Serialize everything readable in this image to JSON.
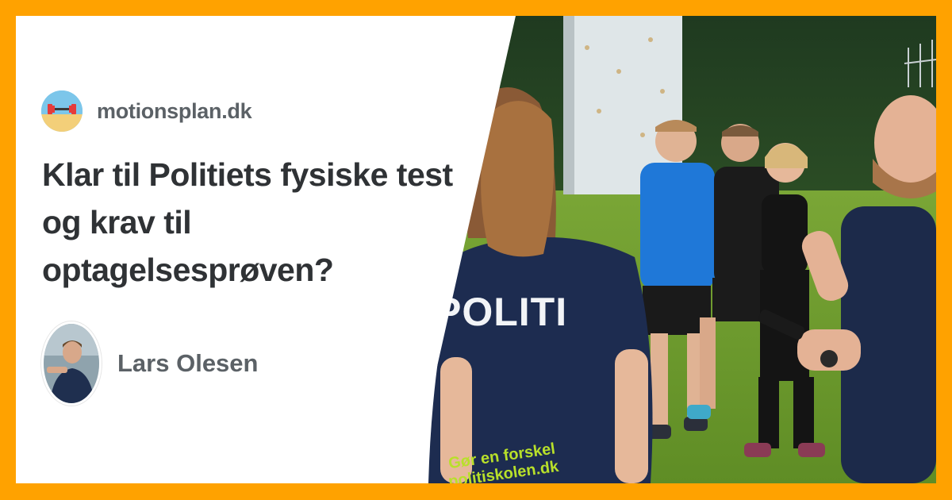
{
  "site": {
    "name": "motionsplan.dk",
    "logo_icon": "dumbbell-beach-icon"
  },
  "article": {
    "title": "Klar til Politiets fysiske test og krav til optagelsesprøven?"
  },
  "author": {
    "name": "Lars Olesen",
    "avatar_icon": "author-avatar"
  },
  "photo": {
    "shirt_back_text": "POLITI",
    "shirt_slogan_line1": "Gør en forskel",
    "shirt_slogan_line2": "politiskolen.dk"
  },
  "colors": {
    "frame": "#ffa200",
    "title": "#2f3235",
    "muted_text": "#5b6166",
    "shirt_navy": "#1d2c50",
    "slogan_green": "#b8e02a",
    "grass": "#6f9e2e"
  }
}
